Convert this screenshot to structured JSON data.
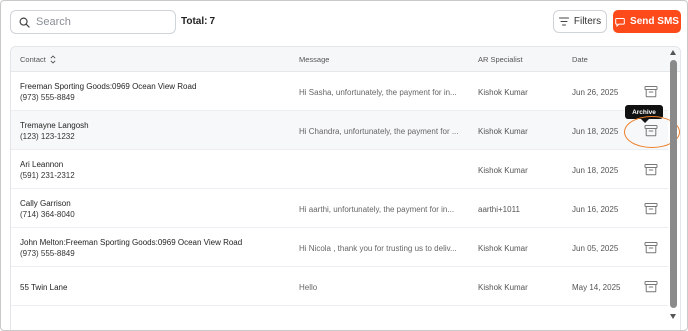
{
  "toolbar": {
    "search_placeholder": "Search",
    "total_label": "Total:",
    "total_value": "7",
    "filters_label": "Filters",
    "send_sms_label": "Send SMS",
    "send_sms_color": "#fc4a1a"
  },
  "table": {
    "headers": {
      "contact": "Contact",
      "message": "Message",
      "ar_specialist": "AR Specialist",
      "date": "Date"
    },
    "rows": [
      {
        "name": "Freeman Sporting Goods:0969 Ocean View Road",
        "phone": "(973) 555-8849",
        "message": "Hi Sasha, unfortunately, the payment for in...",
        "ar": "Kishok Kumar",
        "date": "Jun 26, 2025"
      },
      {
        "name": "Tremayne Langosh",
        "phone": "(123) 123-1232",
        "message": "Hi Chandra, unfortunately, the payment for ...",
        "ar": "Kishok Kumar",
        "date": "Jun 18, 2025"
      },
      {
        "name": "Ari Leannon",
        "phone": "(591) 231-2312",
        "message": "",
        "ar": "Kishok Kumar",
        "date": "Jun 18, 2025"
      },
      {
        "name": "Cally Garrison",
        "phone": "(714) 364-8040",
        "message": "Hi aarthi, unfortunately, the payment for in...",
        "ar": "aarthi+1011",
        "date": "Jun 16, 2025"
      },
      {
        "name": "John Melton:Freeman Sporting Goods:0969 Ocean View Road",
        "phone": "(973) 555-8849",
        "message": "Hi Nicola , thank you for trusting us to deliv...",
        "ar": "Kishok Kumar",
        "date": "Jun 05, 2025"
      },
      {
        "name": "55 Twin Lane",
        "phone": "",
        "message": "Hello",
        "ar": "Kishok Kumar",
        "date": "May 14, 2025"
      }
    ]
  },
  "tooltip": {
    "archive_label": "Archive"
  },
  "icons": {
    "search": "search-icon",
    "filters": "filter-lines-icon",
    "send_sms": "message-bubble-icon",
    "sort": "sort-updown-icon",
    "archive": "archive-box-icon"
  },
  "colors": {
    "accent": "#fc4a1a",
    "annotation_circle": "#ee7f2a",
    "tooltip_bg": "#111111"
  }
}
